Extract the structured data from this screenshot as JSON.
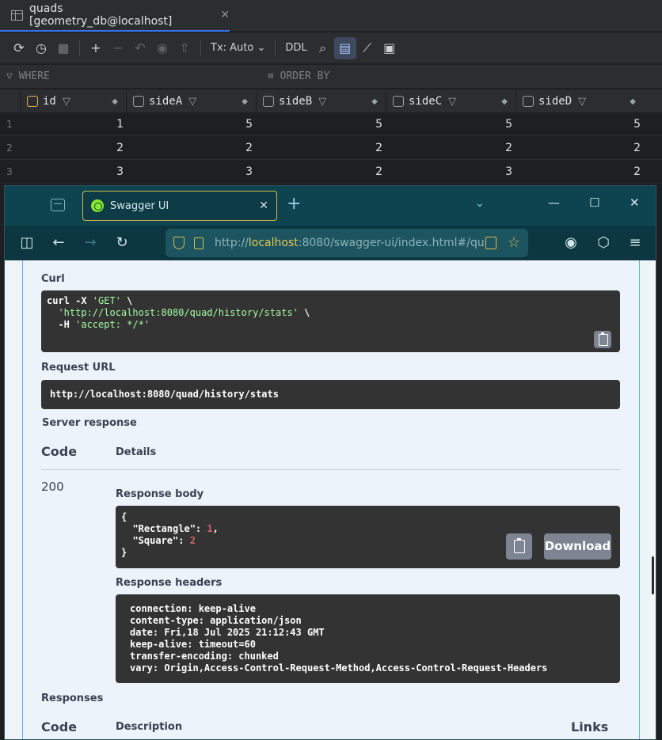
{
  "ide": {
    "tab_title": "quads [geometry_db@localhost]",
    "tab_close": "✕",
    "tx_mode": "Tx: Auto",
    "ddl": "DDL",
    "where_label": "WHERE",
    "orderby_label": "ORDER BY",
    "columns": [
      "id",
      "sideA",
      "sideB",
      "sideC",
      "sideD"
    ],
    "rows": [
      {
        "n": "1",
        "cells": [
          "1",
          "5",
          "5",
          "5",
          "5"
        ]
      },
      {
        "n": "2",
        "cells": [
          "2",
          "2",
          "2",
          "2",
          "2"
        ]
      },
      {
        "n": "3",
        "cells": [
          "3",
          "3",
          "2",
          "3",
          "2"
        ]
      }
    ]
  },
  "browser": {
    "tab_title": "Swagger UI",
    "url_prefix": "http://",
    "url_host": "localhost",
    "url_rest": ":8080/swagger-ui/index.html#/qu",
    "new_tab": "+",
    "minimize": "—",
    "maximize": "☐",
    "close": "✕"
  },
  "swagger": {
    "curl_label": "Curl",
    "curl_line1": "curl -X ",
    "curl_method": "'GET'",
    "curl_line1_end": " \\",
    "curl_url": "'http://localhost:8080/quad/history/stats'",
    "curl_line2_end": " \\",
    "curl_line3": "  -H ",
    "curl_header": "'accept: */*'",
    "request_url_label": "Request URL",
    "request_url": "http://localhost:8080/quad/history/stats",
    "server_response_label": "Server response",
    "code_header": "Code",
    "details_header": "Details",
    "status_code": "200",
    "response_body_label": "Response body",
    "body_open": "{",
    "body_key1": "  \"Rectangle\": ",
    "body_val1": "1",
    "body_key2": "  \"Square\": ",
    "body_val2": "2",
    "body_close": "}",
    "download_label": "Download",
    "response_headers_label": "Response headers",
    "headers": [
      "connection: keep-alive",
      "content-type: application/json",
      "date: Fri,18 Jul 2025 21:12:43 GMT",
      "keep-alive: timeout=60",
      "transfer-encoding: chunked",
      "vary: Origin,Access-Control-Request-Method,Access-Control-Request-Headers"
    ],
    "responses_label": "Responses",
    "responses_code_header": "Code",
    "description_header": "Description",
    "links_header": "Links"
  },
  "colors": {
    "ide_bg": "#1e1f22",
    "browser_bar": "#0e4450",
    "swagger_bg": "#edf3fa",
    "code_bg": "#333333",
    "accent_blue": "#61affe"
  }
}
